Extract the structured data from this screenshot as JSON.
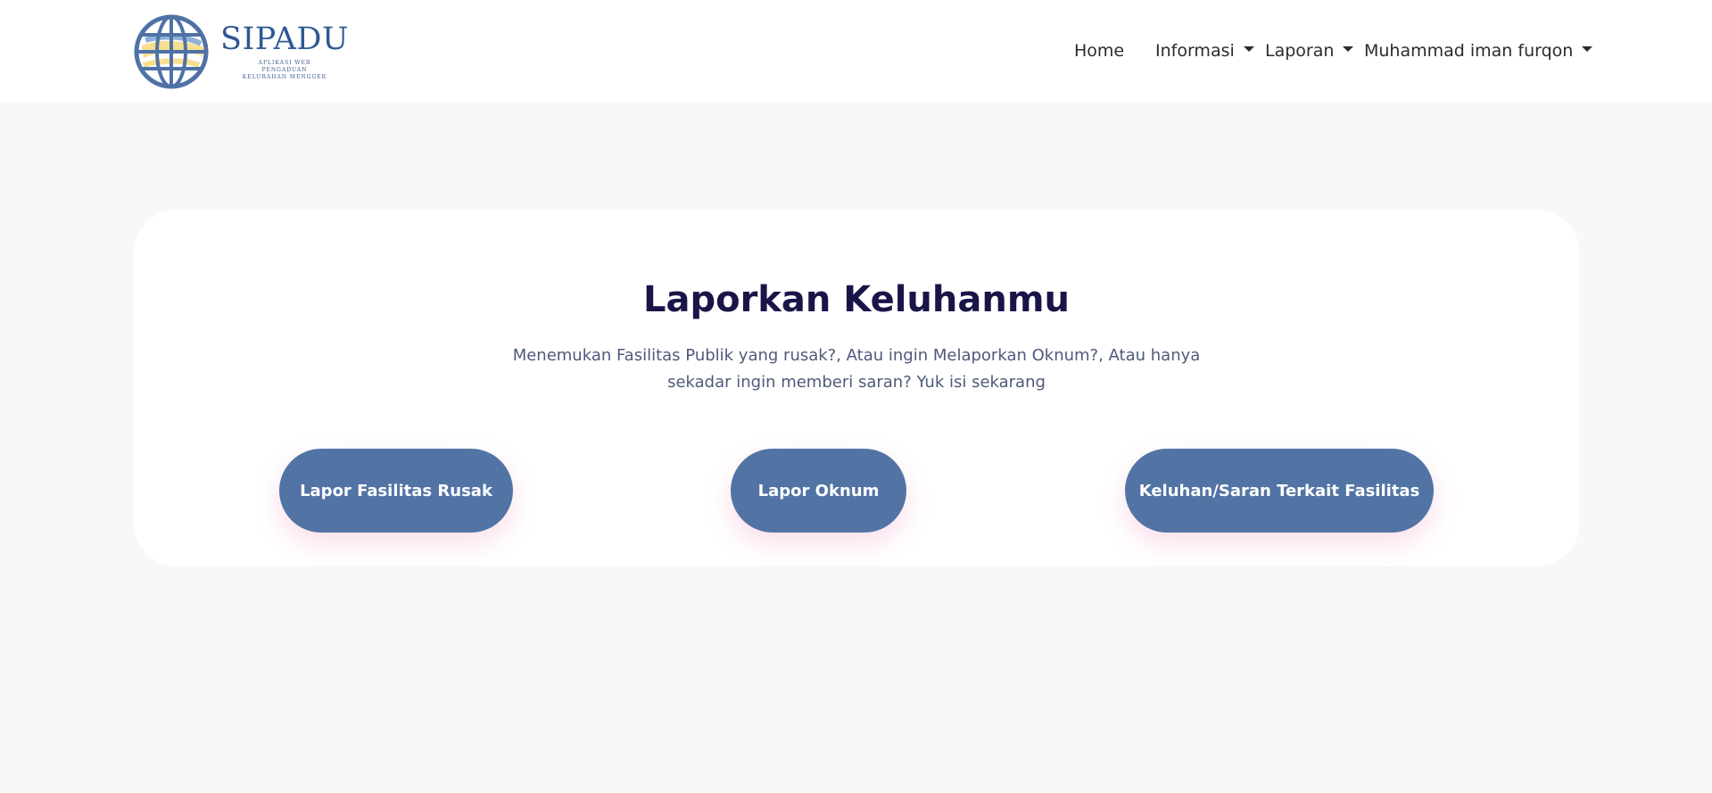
{
  "brand": {
    "name": "SIPADU",
    "tagline_line1": "APLIKASI WEB",
    "tagline_line2": "PENGADUAN",
    "tagline_line3": "KELURAHAN MENGGER"
  },
  "nav": {
    "home": "Home",
    "informasi": "Informasi",
    "laporan": "Laporan",
    "user": "Muhammad iman furqon"
  },
  "main": {
    "title": "Laporkan Keluhanmu",
    "subtitle_line1": "Menemukan Fasilitas Publik yang rusak?, Atau ingin Melaporkan Oknum?, Atau hanya",
    "subtitle_line2": "sekadar ingin memberi saran? Yuk isi sekarang",
    "buttons": {
      "fasilitas": "Lapor Fasilitas Rusak",
      "oknum": "Lapor Oknum",
      "saran": "Keluhan/Saran Terkait Fasilitas"
    }
  },
  "colors": {
    "primary_button": "#5174a5",
    "title": "#1a1548",
    "brand": "#2f5993",
    "background": "#f7f8fa"
  },
  "icons": {
    "logo": "globe-icon",
    "dropdown": "caret-down-icon"
  }
}
